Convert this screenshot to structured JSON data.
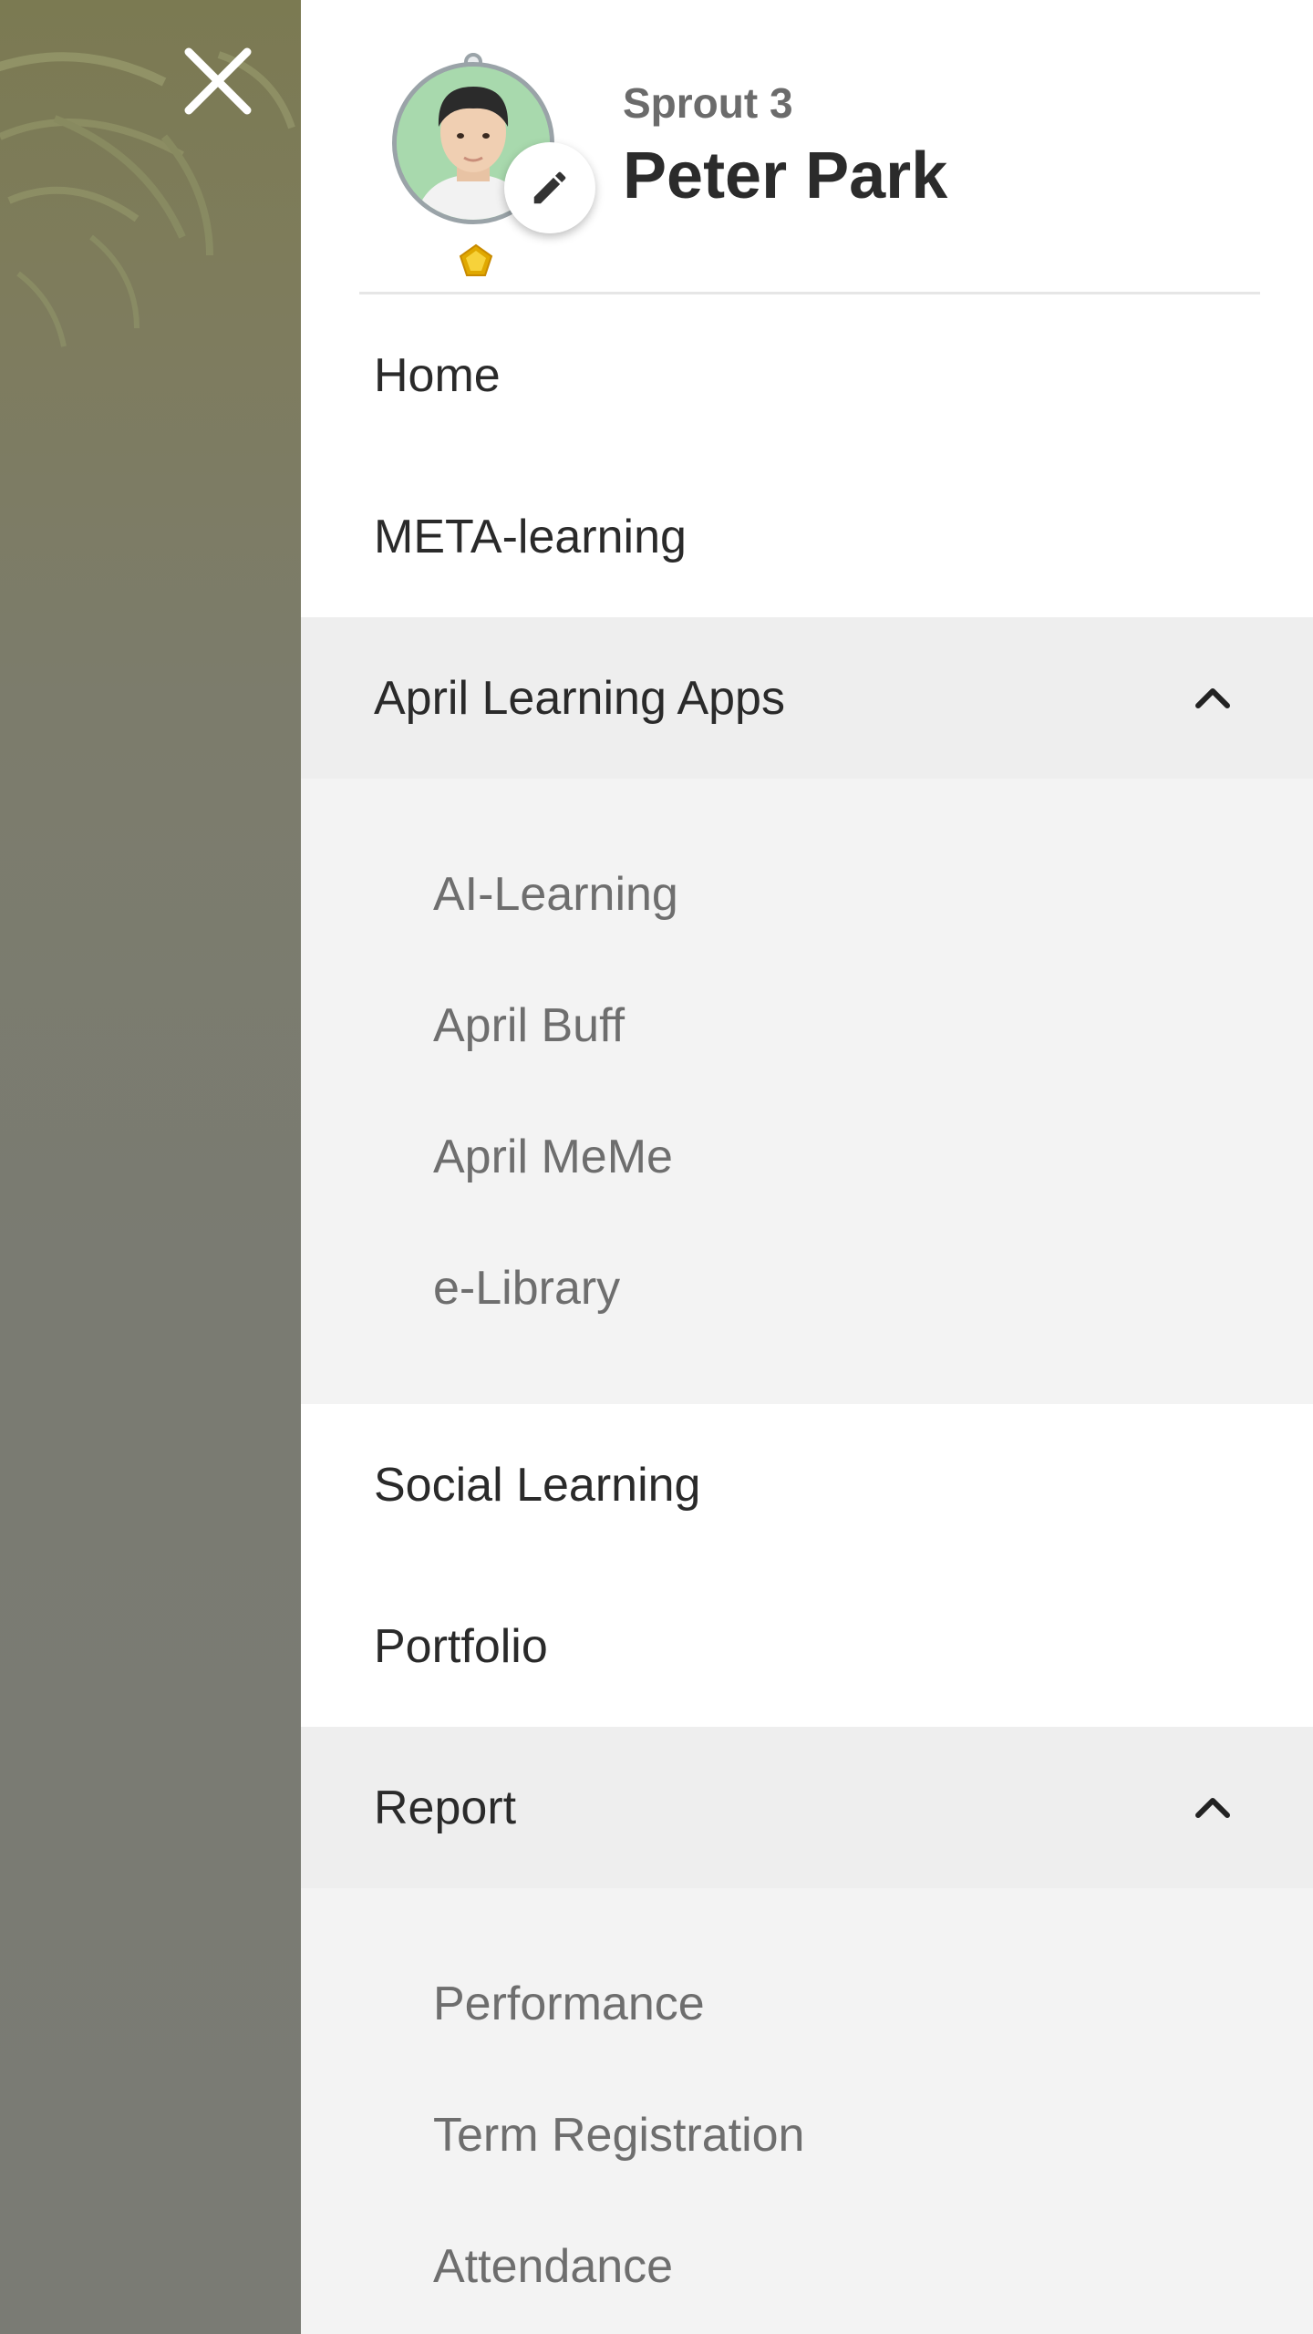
{
  "icons": {
    "close": "close-icon",
    "edit": "pencil-icon",
    "badge": "gem-icon",
    "chevron": "chevron-up-icon"
  },
  "colors": {
    "drawer_bg": "#ffffff",
    "expanded_bg": "#eeeeee",
    "submenu_bg": "#f3f3f3",
    "text_primary": "#2a2a2a",
    "text_secondary": "#6e6e6e",
    "badge_gold": "#f2c21b",
    "avatar_bg": "#a8d9ad"
  },
  "profile": {
    "level": "Sprout 3",
    "name": "Peter Park"
  },
  "menu": {
    "home": "Home",
    "meta_learning": "META-learning",
    "april_apps": {
      "label": "April Learning Apps",
      "items": [
        "AI-Learning",
        "April Buff",
        "April MeMe",
        "e-Library"
      ]
    },
    "social_learning": "Social Learning",
    "portfolio": "Portfolio",
    "report": {
      "label": "Report",
      "items": [
        "Performance",
        "Term Registration",
        "Attendance"
      ]
    }
  }
}
